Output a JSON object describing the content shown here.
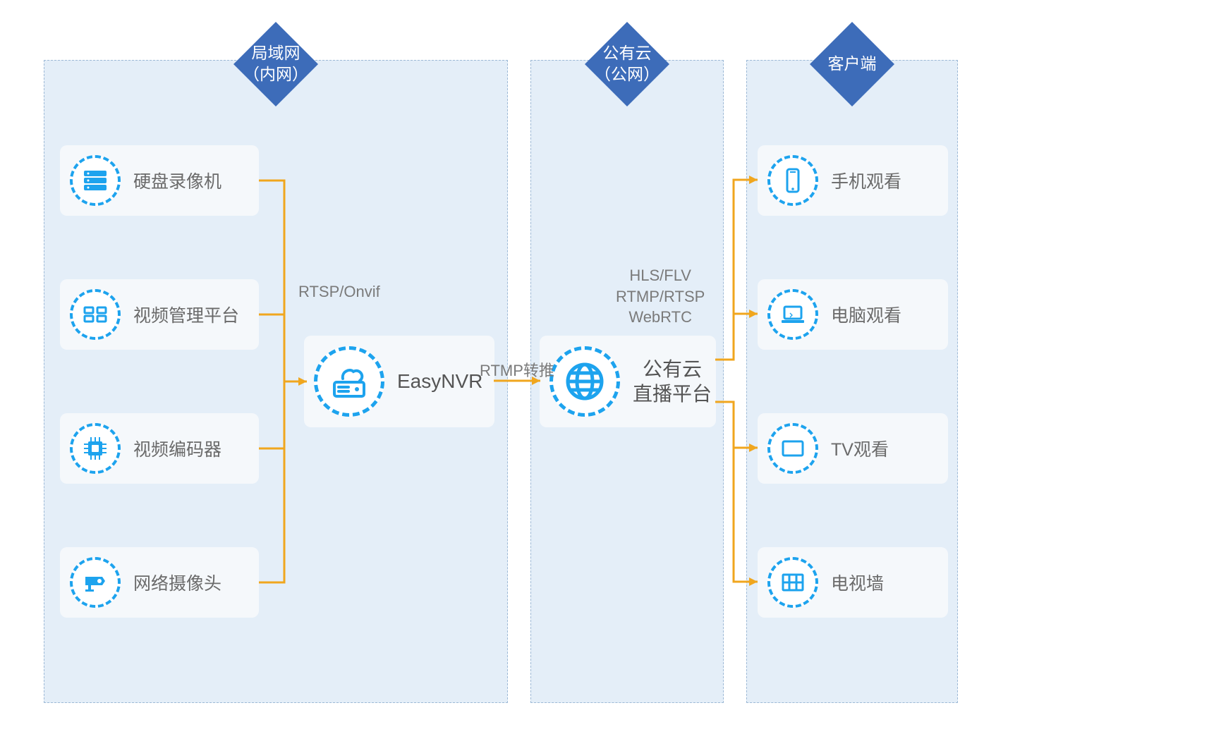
{
  "zones": {
    "lan": {
      "title": "局域网\n（内网）"
    },
    "cloud": {
      "title": "公有云\n（公网）"
    },
    "client": {
      "title": "客户端"
    }
  },
  "inputs": [
    {
      "label": "硬盘录像机"
    },
    {
      "label": "视频管理平台"
    },
    {
      "label": "视频编码器"
    },
    {
      "label": "网络摄像头"
    }
  ],
  "processor": {
    "label": "EasyNVR"
  },
  "input_protocol": "RTSP/Onvif",
  "push_protocol": "RTMP转推",
  "output_protocols": "HLS/FLV\nRTMP/RTSP\nWebRTC",
  "cloud_node": {
    "line1": "公有云",
    "line2": "直播平台"
  },
  "clients": [
    {
      "label": "手机观看"
    },
    {
      "label": "电脑观看"
    },
    {
      "label": "TV观看"
    },
    {
      "label": "电视墙"
    }
  ]
}
